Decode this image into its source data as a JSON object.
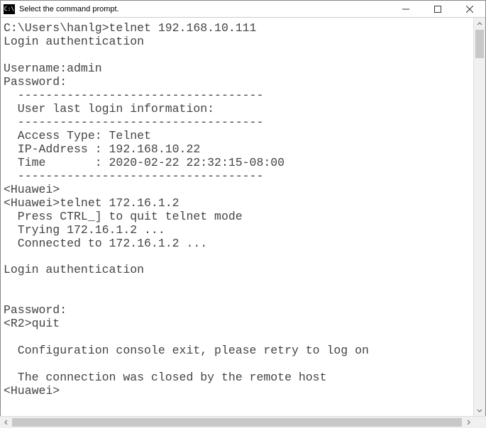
{
  "window": {
    "icon_text": "C:\\",
    "title": "Select the command prompt."
  },
  "terminal": {
    "lines": [
      "C:\\Users\\hanlg>telnet 192.168.10.111",
      "Login authentication",
      "",
      "Username:admin",
      "Password:",
      "  -----------------------------------",
      "  User last login information:",
      "  -----------------------------------",
      "  Access Type: Telnet",
      "  IP-Address : 192.168.10.22",
      "  Time       : 2020-02-22 22:32:15-08:00",
      "  -----------------------------------",
      "<Huawei>",
      "<Huawei>telnet 172.16.1.2",
      "  Press CTRL_] to quit telnet mode",
      "  Trying 172.16.1.2 ...",
      "  Connected to 172.16.1.2 ...",
      "",
      "Login authentication",
      "",
      "",
      "Password:",
      "<R2>quit",
      "",
      "  Configuration console exit, please retry to log on",
      "",
      "  The connection was closed by the remote host",
      "<Huawei>"
    ]
  }
}
